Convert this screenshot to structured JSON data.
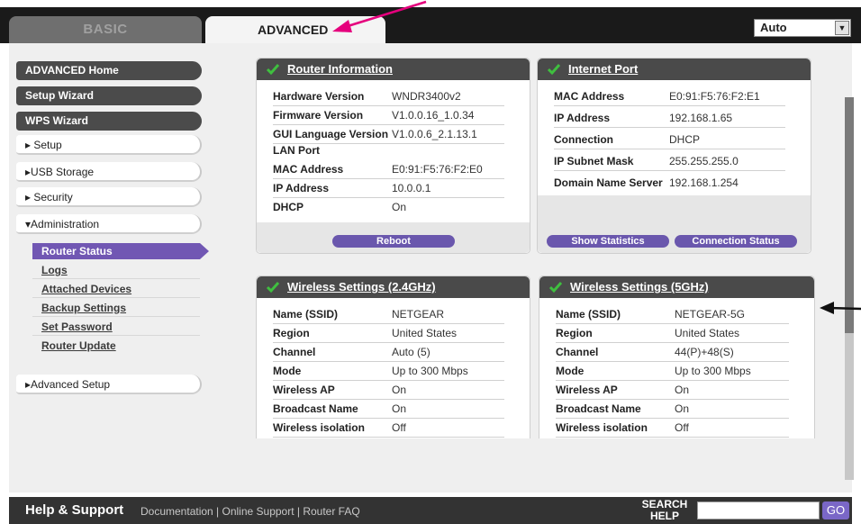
{
  "tabs": {
    "basic": "BASIC",
    "advanced": "ADVANCED"
  },
  "language_select": {
    "value": "Auto"
  },
  "sidebar": {
    "advanced_home": "ADVANCED Home",
    "setup_wizard": "Setup Wizard",
    "wps_wizard": "WPS Wizard",
    "setup": "▸ Setup",
    "usb_storage": "▸USB Storage",
    "security": "▸ Security",
    "administration": "▾Administration",
    "admin_items": [
      "Router Status",
      "Logs",
      "Attached Devices",
      "Backup Settings",
      "Set Password",
      "Router Update"
    ],
    "advanced_setup": "▸Advanced Setup"
  },
  "router_info": {
    "title": "Router Information",
    "rows": [
      {
        "k": "Hardware Version",
        "v": "WNDR3400v2"
      },
      {
        "k": "Firmware Version",
        "v": "V1.0.0.16_1.0.34"
      },
      {
        "k": "GUI Language Version",
        "v": "V1.0.0.6_2.1.13.1"
      }
    ],
    "lan_label": "LAN Port",
    "lan_rows": [
      {
        "k": "MAC Address",
        "v": "E0:91:F5:76:F2:E0"
      },
      {
        "k": "IP Address",
        "v": "10.0.0.1"
      },
      {
        "k": "DHCP",
        "v": "On"
      }
    ],
    "reboot": "Reboot"
  },
  "internet_port": {
    "title": "Internet Port",
    "rows": [
      {
        "k": "MAC Address",
        "v": "E0:91:F5:76:F2:E1"
      },
      {
        "k": "IP Address",
        "v": "192.168.1.65"
      },
      {
        "k": "Connection",
        "v": "DHCP"
      },
      {
        "k": "IP Subnet Mask",
        "v": "255.255.255.0"
      },
      {
        "k": "Domain Name Server",
        "v": "192.168.1.254"
      }
    ],
    "show_statistics": "Show Statistics",
    "connection_status": "Connection Status"
  },
  "wireless_24": {
    "title": "Wireless Settings (2.4GHz)",
    "rows": [
      {
        "k": "Name (SSID)",
        "v": "NETGEAR"
      },
      {
        "k": "Region",
        "v": "United States"
      },
      {
        "k": "Channel",
        "v": "Auto (5)"
      },
      {
        "k": "Mode",
        "v": "Up to 300 Mbps"
      },
      {
        "k": "Wireless AP",
        "v": "On"
      },
      {
        "k": "Broadcast Name",
        "v": "On"
      },
      {
        "k": "Wireless isolation",
        "v": "Off"
      }
    ]
  },
  "wireless_5": {
    "title": "Wireless Settings (5GHz)",
    "rows": [
      {
        "k": "Name (SSID)",
        "v": "NETGEAR-5G"
      },
      {
        "k": "Region",
        "v": "United States"
      },
      {
        "k": "Channel",
        "v": "44(P)+48(S)"
      },
      {
        "k": "Mode",
        "v": "Up to 300 Mbps"
      },
      {
        "k": "Wireless AP",
        "v": "On"
      },
      {
        "k": "Broadcast Name",
        "v": "On"
      },
      {
        "k": "Wireless isolation",
        "v": "Off"
      }
    ]
  },
  "footer": {
    "help_support": "Help & Support",
    "links": "Documentation  |  Online Support  |  Router FAQ",
    "search_label": "SEARCH HELP",
    "go": "GO"
  },
  "colors": {
    "accent": "#7157b3",
    "header_dark": "#4a4a4a",
    "check": "#3fbf3f",
    "annotation_arrow": "#e5007d"
  }
}
